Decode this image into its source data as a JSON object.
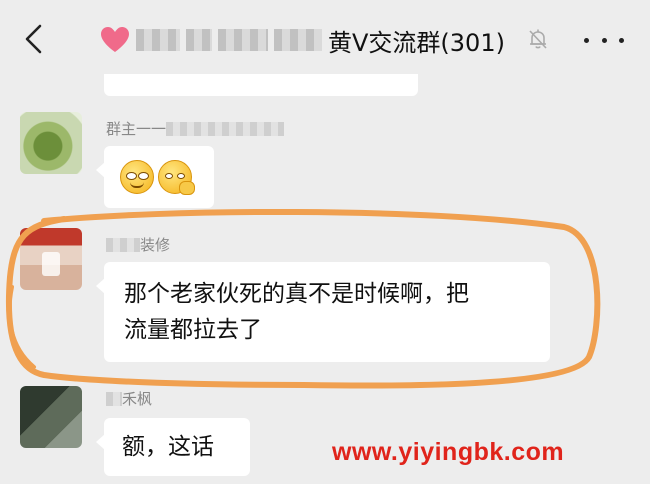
{
  "header": {
    "back_icon": "chevron-left-icon",
    "group_icon": "heart-icon",
    "title_visible": "黄V交流群(301)",
    "mute_icon": "bell-muted-icon",
    "more_icon": "more-dots-icon"
  },
  "messages": [
    {
      "sender": "群主一一",
      "type": "emoji",
      "emojis": [
        "squint-grin-emoji",
        "thinking-face-emoji"
      ]
    },
    {
      "sender": "装修",
      "text_line1": "那个老家伙死的真不是时候啊，把",
      "text_line2": "流量都拉去了"
    },
    {
      "sender": "禾枫",
      "text": "额，这话"
    }
  ],
  "annotation": {
    "color": "#f0a050"
  },
  "watermark": "www.yiyingbk.com",
  "colors": {
    "background": "#ededed",
    "bubble": "#ffffff",
    "watermark": "#e0241b",
    "ring": "#f0a050"
  }
}
